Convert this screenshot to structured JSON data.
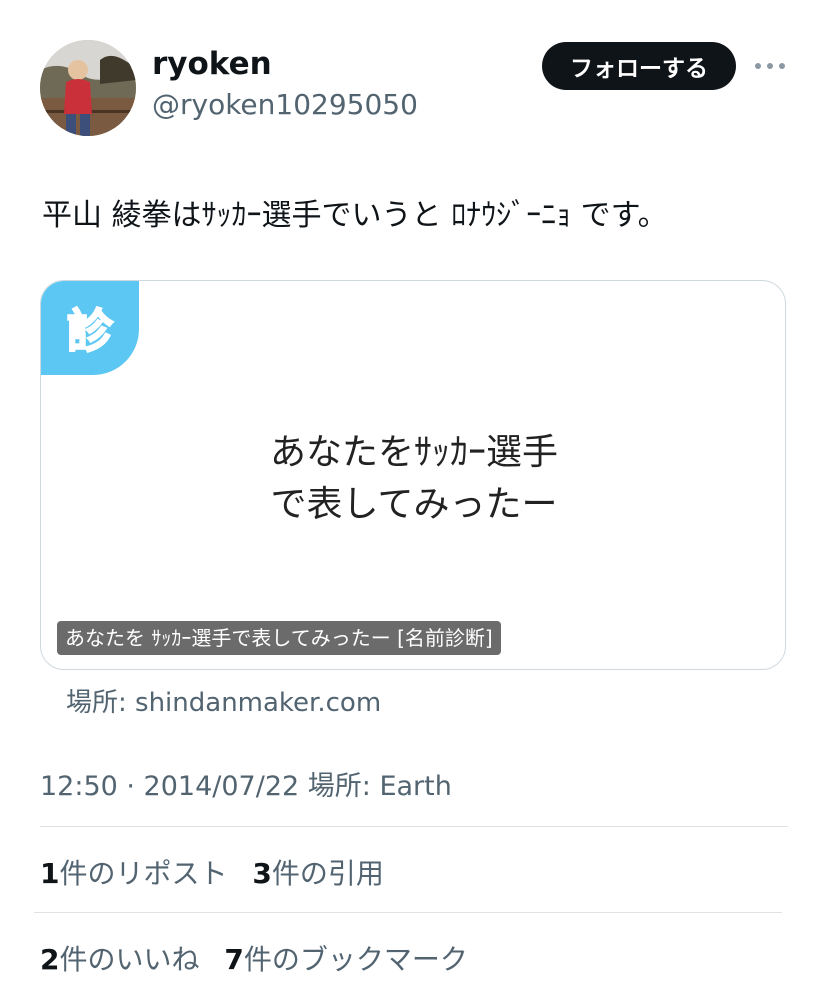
{
  "author": {
    "display_name": "ryoken",
    "handle": "@ryoken10295050"
  },
  "follow_label": "フォローする",
  "tweet_text": "平山 綾拳はｻｯｶｰ選手でいうと ﾛﾅｳｼﾞｰﾆｮ です。",
  "card": {
    "badge": "診",
    "title_line1": "あなたをｻｯｶｰ選手",
    "title_line2": "で表してみったー",
    "caption": "あなたを ｻｯｶｰ選手で表してみったー [名前診断]",
    "source": "場所: shindanmaker.com"
  },
  "timestamp": "12:50 · 2014/07/22 場所: Earth",
  "stats": {
    "reposts_count": "1",
    "reposts_label": "件のリポスト",
    "quotes_count": "3",
    "quotes_label": "件の引用",
    "likes_count": "2",
    "likes_label": "件のいいね",
    "bookmarks_count": "7",
    "bookmarks_label": "件のブックマーク"
  },
  "icons": {
    "more": "more-horizontal-icon",
    "avatar": "avatar-photo"
  },
  "colors": {
    "follow_bg": "#0f1419",
    "badge_bg": "#5bc7f2",
    "secondary_text": "#536471"
  }
}
